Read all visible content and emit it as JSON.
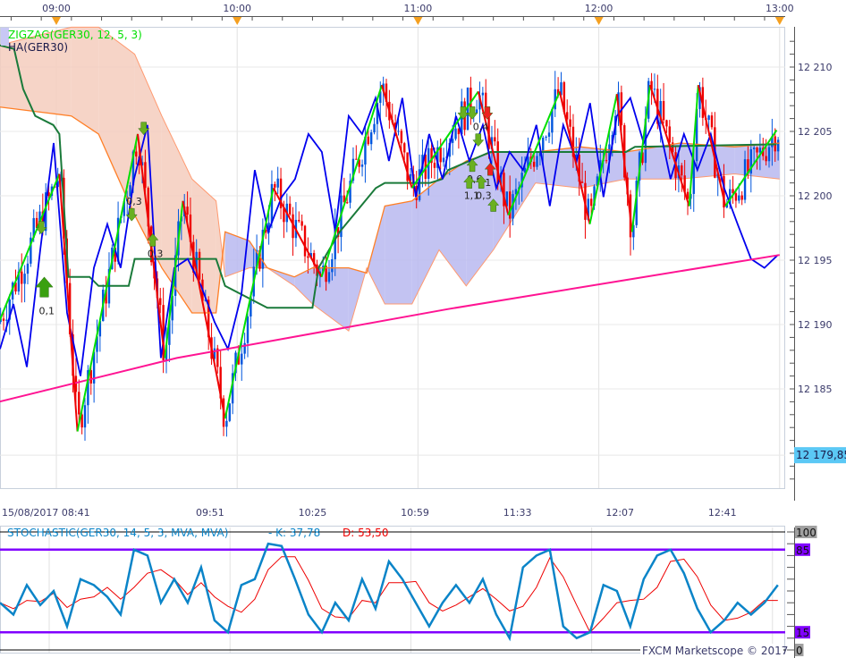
{
  "chart_data": {
    "type": "line",
    "x_units": "minutes after 08:00",
    "price_range": [
      12177.3,
      12212.8
    ],
    "top_time_labels": [
      {
        "t": 60,
        "label": "09:00"
      },
      {
        "t": 120,
        "label": "10:00"
      },
      {
        "t": 180,
        "label": "11:00"
      },
      {
        "t": 240,
        "label": "12:00"
      },
      {
        "t": 300,
        "label": "13:00"
      }
    ],
    "bottom_time_labels": [
      {
        "t": 41,
        "label": "15/08/2017 08:41"
      },
      {
        "t": 111,
        "label": "09:51"
      },
      {
        "t": 145,
        "label": "10:25"
      },
      {
        "t": 179,
        "label": "10:59"
      },
      {
        "t": 213,
        "label": "11:33"
      },
      {
        "t": 247,
        "label": "12:07"
      },
      {
        "t": 281,
        "label": "12:41"
      }
    ],
    "price_ticks": [
      {
        "p": 12210,
        "label": "12 210"
      },
      {
        "p": 12205,
        "label": "12 205"
      },
      {
        "p": 12200,
        "label": "12 200"
      },
      {
        "p": 12195,
        "label": "12 195"
      },
      {
        "p": 12190,
        "label": "12 190"
      },
      {
        "p": 12185,
        "label": "12 185"
      }
    ],
    "current_price": {
      "p": 12179.85,
      "label": "12 179,85",
      "color": "#5bc8f5"
    },
    "legend": [
      {
        "label": "ZIGZAG(GER30, 12, 5, 3)",
        "color": "#00e000"
      },
      {
        "label": "HA(GER30)",
        "color": "#1a1a4a"
      }
    ],
    "sma": {
      "color": "#ff1493",
      "points": [
        [
          41,
          12184.0
        ],
        [
          100,
          12187.4
        ],
        [
          190,
          12191.2
        ],
        [
          250,
          12193.5
        ],
        [
          300,
          12195.4
        ]
      ]
    },
    "blue_line": {
      "color": "#0000ee",
      "start_t": 41.3,
      "step_min": 4.45,
      "values": [
        12188.1,
        12191.6,
        12186.7,
        12195.8,
        12204.1,
        12190.9,
        12186.0,
        12194.4,
        12197.8,
        12194.4,
        12201.3,
        12205.5,
        12187.4,
        12194.4,
        12195.1,
        12193.0,
        12190.2,
        12188.1,
        12192.3,
        12202.0,
        12197.2,
        12199.9,
        12201.3,
        12204.8,
        12203.4,
        12197.2,
        12206.2,
        12204.8,
        12207.6,
        12202.7,
        12207.6,
        12199.9,
        12204.8,
        12201.3,
        12206.2,
        12202.7,
        12205.5,
        12200.6,
        12203.4,
        12202.0,
        12205.5,
        12199.2,
        12205.5,
        12202.7,
        12207.2,
        12199.9,
        12206.2,
        12207.6,
        12204.1,
        12206.2,
        12201.3,
        12204.8,
        12202.0,
        12204.8,
        12200.6,
        12197.8,
        12195.1,
        12194.4,
        12195.4
      ]
    },
    "zigzag": {
      "up_color": "#00e000",
      "down_color": "#ee0000",
      "points": [
        [
          41,
          12190.2
        ],
        [
          61,
          12201.7
        ],
        [
          67,
          12181.7
        ],
        [
          87,
          12204.8
        ],
        [
          96,
          12187.4
        ],
        [
          102,
          12199.6
        ],
        [
          116,
          12182.7
        ],
        [
          132,
          12200.6
        ],
        [
          148,
          12193.7
        ],
        [
          168,
          12208.6
        ],
        [
          178,
          12200.6
        ],
        [
          200,
          12208.1
        ],
        [
          210,
          12198.5
        ],
        [
          227,
          12208.1
        ],
        [
          237,
          12197.8
        ],
        [
          246,
          12207.9
        ],
        [
          251,
          12197.2
        ],
        [
          257,
          12208.6
        ],
        [
          270,
          12199.2
        ],
        [
          273,
          12208.6
        ],
        [
          282,
          12199.2
        ],
        [
          299,
          12205.1
        ]
      ]
    },
    "ha_step_line": {
      "color": "#1a7a3a",
      "points": [
        [
          41,
          12211.7
        ],
        [
          46,
          12211.4
        ],
        [
          49,
          12208.3
        ],
        [
          53,
          12206.2
        ],
        [
          59,
          12205.5
        ],
        [
          61,
          12204.8
        ],
        [
          64,
          12193.7
        ],
        [
          71,
          12193.7
        ],
        [
          74,
          12193.0
        ],
        [
          84,
          12193.0
        ],
        [
          86,
          12195.1
        ],
        [
          96,
          12195.1
        ],
        [
          113,
          12195.1
        ],
        [
          116,
          12193.0
        ],
        [
          130,
          12191.3
        ],
        [
          145,
          12191.3
        ],
        [
          147,
          12194.4
        ],
        [
          154,
          12197.2
        ],
        [
          166,
          12200.6
        ],
        [
          169,
          12201.0
        ],
        [
          184,
          12201.0
        ],
        [
          188,
          12201.3
        ],
        [
          190,
          12202.0
        ],
        [
          204,
          12203.4
        ],
        [
          249,
          12203.4
        ],
        [
          252,
          12203.8
        ],
        [
          299,
          12204.0
        ]
      ]
    },
    "cloud": {
      "bull_color": "#b8b8f0",
      "bear_color": "#f5cdbd",
      "span_a_color": "#ff7f27",
      "t": [
        41,
        65,
        74,
        86,
        95,
        105,
        113,
        116,
        124,
        130,
        139,
        145,
        157,
        163,
        169,
        178,
        187,
        196,
        205,
        219,
        234,
        249,
        267,
        285,
        300
      ],
      "span_a": [
        12206.9,
        12206.2,
        12204.8,
        12198.5,
        12194.4,
        12190.9,
        12190.9,
        12197.2,
        12196.5,
        12194.4,
        12193.7,
        12194.4,
        12194.4,
        12194.0,
        12199.2,
        12199.6,
        12201.3,
        12202.7,
        12203.4,
        12203.4,
        12203.8,
        12203.4,
        12204.1,
        12203.8,
        12204.1
      ],
      "span_b": [
        12211.7,
        12213.1,
        12213.1,
        12211.0,
        12206.2,
        12201.3,
        12199.6,
        12193.7,
        12194.4,
        12194.4,
        12193.0,
        12191.6,
        12189.5,
        12194.4,
        12191.6,
        12191.6,
        12195.8,
        12193.0,
        12195.8,
        12201.0,
        12200.6,
        12201.3,
        12201.3,
        12201.7,
        12201.3
      ]
    },
    "candles": {
      "up_color": "#0055dd",
      "down_color": "#ee0000",
      "note": "HA candles"
    },
    "markers": [
      {
        "type": "up",
        "color": "#3aa010",
        "t": 56,
        "p": 12192.8,
        "big": true,
        "label": "0,1"
      },
      {
        "type": "down",
        "color": "#6ab020",
        "t": 55,
        "p": 12197.6,
        "label": ""
      },
      {
        "type": "down",
        "color": "#6ab020",
        "t": 89,
        "p": 12205.3,
        "label": ""
      },
      {
        "type": "down",
        "color": "#6ab020",
        "t": 85,
        "p": 12198.6,
        "label": "0,3"
      },
      {
        "type": "up",
        "color": "#6ab020",
        "t": 92,
        "p": 12196.5,
        "label": "0,3"
      },
      {
        "type": "down",
        "color": "#6ab020",
        "t": 195,
        "p": 12206.5,
        "label": ""
      },
      {
        "type": "down",
        "color": "#6ab020",
        "t": 198,
        "p": 12206.5,
        "label": ""
      },
      {
        "type": "down",
        "color": "#ee2020",
        "t": 203,
        "p": 12206.5,
        "label": ""
      },
      {
        "type": "down",
        "color": "#6ab020",
        "t": 200,
        "p": 12204.4,
        "label": "0,4"
      },
      {
        "type": "up",
        "color": "#6ab020",
        "t": 198,
        "p": 12202.3,
        "label": "0,6"
      },
      {
        "type": "up",
        "color": "#ee2020",
        "t": 204,
        "p": 12202.0,
        "label": "1"
      },
      {
        "type": "up",
        "color": "#6ab020",
        "t": 197,
        "p": 12201.0,
        "label": "1,1"
      },
      {
        "type": "up",
        "color": "#6ab020",
        "t": 201,
        "p": 12201.0,
        "label": "0,3"
      },
      {
        "type": "up",
        "color": "#6ab020",
        "t": 205,
        "p": 12199.2,
        "label": ""
      }
    ],
    "stochastic": {
      "label": "STOCHASTIC(GER30, 14, 5, 3, MVA, MVA)",
      "k_label": "- K: 37,78",
      "d_label": "D: 53,50",
      "k_color": "#0a84c8",
      "d_color": "#ee0000",
      "level_color": "#8000ff",
      "levels": [
        {
          "v": 100,
          "label": "100",
          "bg": "#a0a0a0"
        },
        {
          "v": 85,
          "label": "85",
          "bg": "#8000ff"
        },
        {
          "v": 15,
          "label": "15",
          "bg": "#8000ff"
        },
        {
          "v": 0,
          "label": "0",
          "bg": "#a0a0a0"
        }
      ],
      "range": [
        0,
        100
      ],
      "start_t": 41.3,
      "step_min": 4.45,
      "k": [
        40,
        30,
        55,
        38,
        50,
        20,
        60,
        55,
        45,
        30,
        85,
        80,
        40,
        60,
        40,
        70,
        25,
        15,
        55,
        60,
        90,
        88,
        60,
        30,
        15,
        40,
        25,
        60,
        35,
        75,
        60,
        40,
        20,
        40,
        55,
        40,
        60,
        30,
        10,
        70,
        80,
        85,
        20,
        10,
        15,
        55,
        50,
        20,
        60,
        80,
        85,
        65,
        35,
        15,
        25,
        40,
        30,
        40,
        55
      ],
      "d": [
        40,
        35,
        42,
        41,
        48,
        36,
        43,
        45,
        53,
        43,
        53,
        65,
        68,
        60,
        47,
        57,
        45,
        37,
        32,
        43,
        68,
        79,
        79,
        59,
        35,
        28,
        27,
        42,
        40,
        57,
        57,
        58,
        40,
        33,
        38,
        45,
        52,
        43,
        33,
        37,
        53,
        78,
        62,
        38,
        15,
        27,
        40,
        42,
        43,
        53,
        75,
        77,
        62,
        38,
        25,
        27,
        32,
        42,
        42
      ]
    },
    "copyright": "FXCM Marketscope © 2017"
  }
}
